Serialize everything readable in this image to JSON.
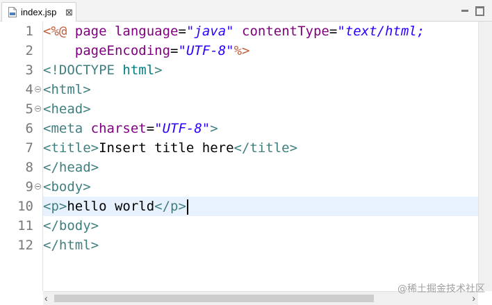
{
  "tab": {
    "label": "index.jsp",
    "close": "⊠"
  },
  "code": {
    "lines": [
      {
        "n": "1",
        "fold": false,
        "segs": [
          [
            "t-dir",
            "<%@ "
          ],
          [
            "t-attr",
            "page "
          ],
          [
            "t-attr",
            "language"
          ],
          [
            "t-text",
            "="
          ],
          [
            "t-str",
            "\"java\""
          ],
          [
            "t-text",
            " "
          ],
          [
            "t-attr",
            "contentType"
          ],
          [
            "t-text",
            "="
          ],
          [
            "t-str",
            "\"text/html;"
          ]
        ]
      },
      {
        "n": "2",
        "fold": false,
        "segs": [
          [
            "t-text",
            "    "
          ],
          [
            "t-attr",
            "pageEncoding"
          ],
          [
            "t-text",
            "="
          ],
          [
            "t-str",
            "\"UTF-8\""
          ],
          [
            "t-dir",
            "%>"
          ]
        ]
      },
      {
        "n": "3",
        "fold": false,
        "segs": [
          [
            "t-tag",
            "<!DOCTYPE "
          ],
          [
            "t-doctype",
            "html"
          ],
          [
            "t-tag",
            ">"
          ]
        ]
      },
      {
        "n": "4",
        "fold": true,
        "segs": [
          [
            "t-tag",
            "<html>"
          ]
        ]
      },
      {
        "n": "5",
        "fold": true,
        "segs": [
          [
            "t-tag",
            "<head>"
          ]
        ]
      },
      {
        "n": "6",
        "fold": false,
        "segs": [
          [
            "t-tag",
            "<meta "
          ],
          [
            "t-attr",
            "charset"
          ],
          [
            "t-text",
            "="
          ],
          [
            "t-str",
            "\"UTF-8\""
          ],
          [
            "t-tag",
            ">"
          ]
        ]
      },
      {
        "n": "7",
        "fold": false,
        "segs": [
          [
            "t-tag",
            "<title>"
          ],
          [
            "t-text",
            "Insert title here"
          ],
          [
            "t-tag",
            "</title>"
          ]
        ]
      },
      {
        "n": "8",
        "fold": false,
        "segs": [
          [
            "t-tag",
            "</head>"
          ]
        ]
      },
      {
        "n": "9",
        "fold": true,
        "segs": [
          [
            "t-tag",
            "<body>"
          ]
        ]
      },
      {
        "n": "10",
        "fold": false,
        "caret": true,
        "segs": [
          [
            "t-tag",
            "<p>"
          ],
          [
            "t-text",
            "hello world"
          ],
          [
            "t-tag",
            "</p>"
          ]
        ]
      },
      {
        "n": "11",
        "fold": false,
        "segs": [
          [
            "t-tag",
            "</body>"
          ]
        ]
      },
      {
        "n": "12",
        "fold": false,
        "segs": [
          [
            "t-tag",
            "</html>"
          ]
        ]
      }
    ]
  },
  "scroll": {
    "left_arrow": "‹",
    "right_arrow": "›"
  },
  "watermark": "@稀土掘金技术社区"
}
